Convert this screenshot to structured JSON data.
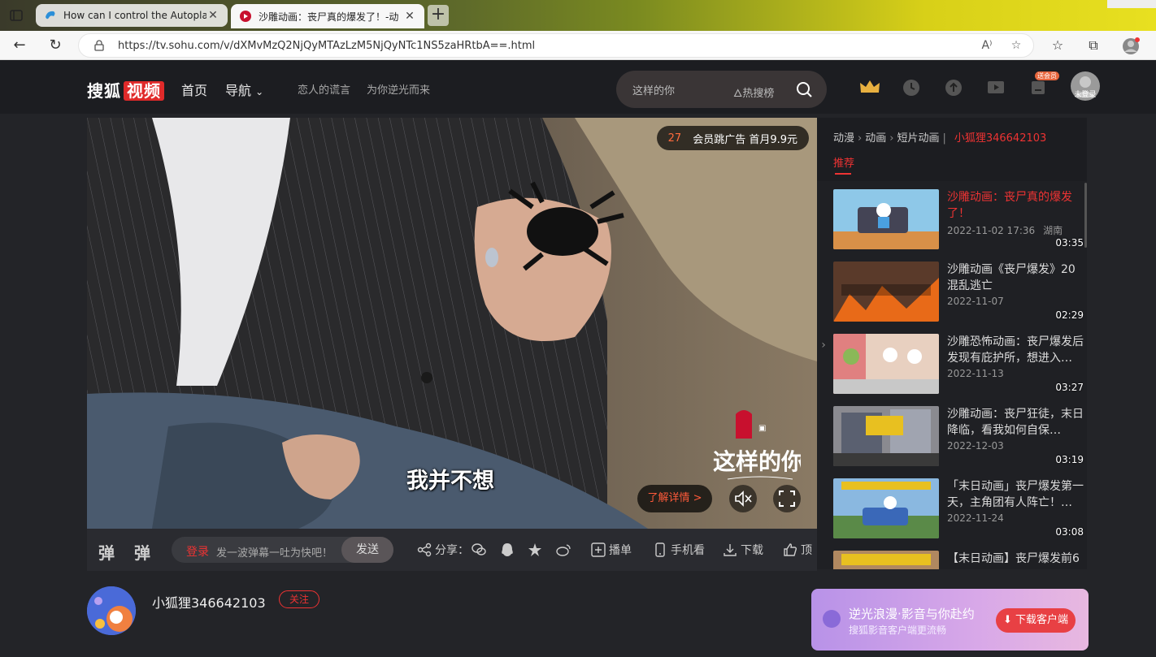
{
  "browser": {
    "tabs": [
      {
        "title": "How can I control the Autoplay o",
        "active": false
      },
      {
        "title": "沙雕动画：丧尸真的爆发了！-动",
        "active": true
      }
    ],
    "new_tab": "+",
    "url": "https://tv.sohu.com/v/dXMvMzQ2NjQyMTAzLzM5NjQyNTc1NS5zaHRtbA==.html"
  },
  "header": {
    "logo_text": "搜狐",
    "logo_badge": "视频",
    "nav": [
      "首页",
      "导航"
    ],
    "sub_links": [
      "恋人的谎言",
      "为你逆光而来"
    ],
    "search_placeholder": "这样的你",
    "hot_label": "热搜榜",
    "gift_badge": "送会员",
    "login_label": "未登录"
  },
  "player": {
    "ad_countdown": "27",
    "ad_text": "会员跳广告 首月9.9元",
    "subtitle": "我并不想",
    "watermark": "这样的你",
    "learn_more": "了解详情 >"
  },
  "controls": {
    "danmu_icon1": "弹",
    "danmu_icon2": "弹",
    "login": "登录",
    "danmu_placeholder": "发一波弹幕一吐为快吧！",
    "send": "发送",
    "share": "分享：",
    "playlist": "播单",
    "mobile": "手机看",
    "download": "下载",
    "like": "顶"
  },
  "side": {
    "breadcrumbs": [
      "动漫",
      "动画",
      "短片动画"
    ],
    "author": "小狐狸346642103",
    "tab": "推荐",
    "items": [
      {
        "title": "沙雕动画：丧尸真的爆发了！",
        "date": "2022-11-02 17:36",
        "loc": "湖南",
        "duration": "03:35",
        "current": true
      },
      {
        "title": "沙雕动画《丧尸爆发》20混乱逃亡",
        "date": "2022-11-07",
        "loc": "",
        "duration": "02:29",
        "current": false
      },
      {
        "title": "沙雕恐怖动画：丧尸爆发后发现有庇护所，想进入…",
        "date": "2022-11-13",
        "loc": "",
        "duration": "03:27",
        "current": false
      },
      {
        "title": "沙雕动画：丧尸狂徒，末日降临，看我如何自保…",
        "date": "2022-12-03",
        "loc": "",
        "duration": "03:19",
        "current": false
      },
      {
        "title": "「末日动画」丧尸爆发第一天，主角团有人阵亡！…",
        "date": "2022-11-24",
        "loc": "",
        "duration": "03:08",
        "current": false
      },
      {
        "title": "【末日动画】丧尸爆发前6",
        "date": "",
        "loc": "",
        "duration": "",
        "current": false
      }
    ]
  },
  "uploader": {
    "name": "小狐狸346642103",
    "follow": "关注"
  },
  "promo": {
    "title": "逆光浪漫·影音与你赴约",
    "subtitle": "搜狐影音客户端更流畅",
    "button": "下载客户端"
  },
  "colors": {
    "accent": "#e33333",
    "bg": "#232428"
  }
}
